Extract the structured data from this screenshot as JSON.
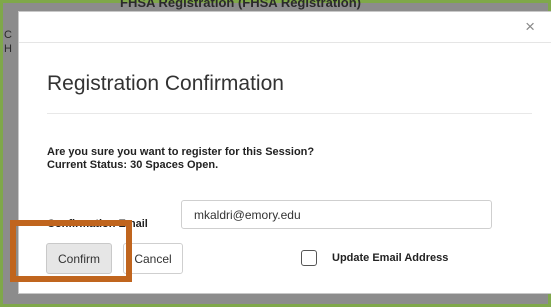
{
  "background": {
    "title_fragment": "FHSA Registration (FHSA Registration)",
    "left_fragment": "C\nH"
  },
  "modal": {
    "close_glyph": "×",
    "title": "Registration Confirmation",
    "question_line1": "Are you sure you want to register for this Session?",
    "question_line2": "Current Status: 30 Spaces Open.",
    "email_label": "Confirmation Email",
    "email_value": "mkaldri@emory.edu",
    "confirm_label": "Confirm",
    "cancel_label": "Cancel",
    "update_email_label": "Update Email Address",
    "update_email_checked": false
  },
  "colors": {
    "highlight": "#c0651e",
    "frame": "#7fa84a"
  }
}
